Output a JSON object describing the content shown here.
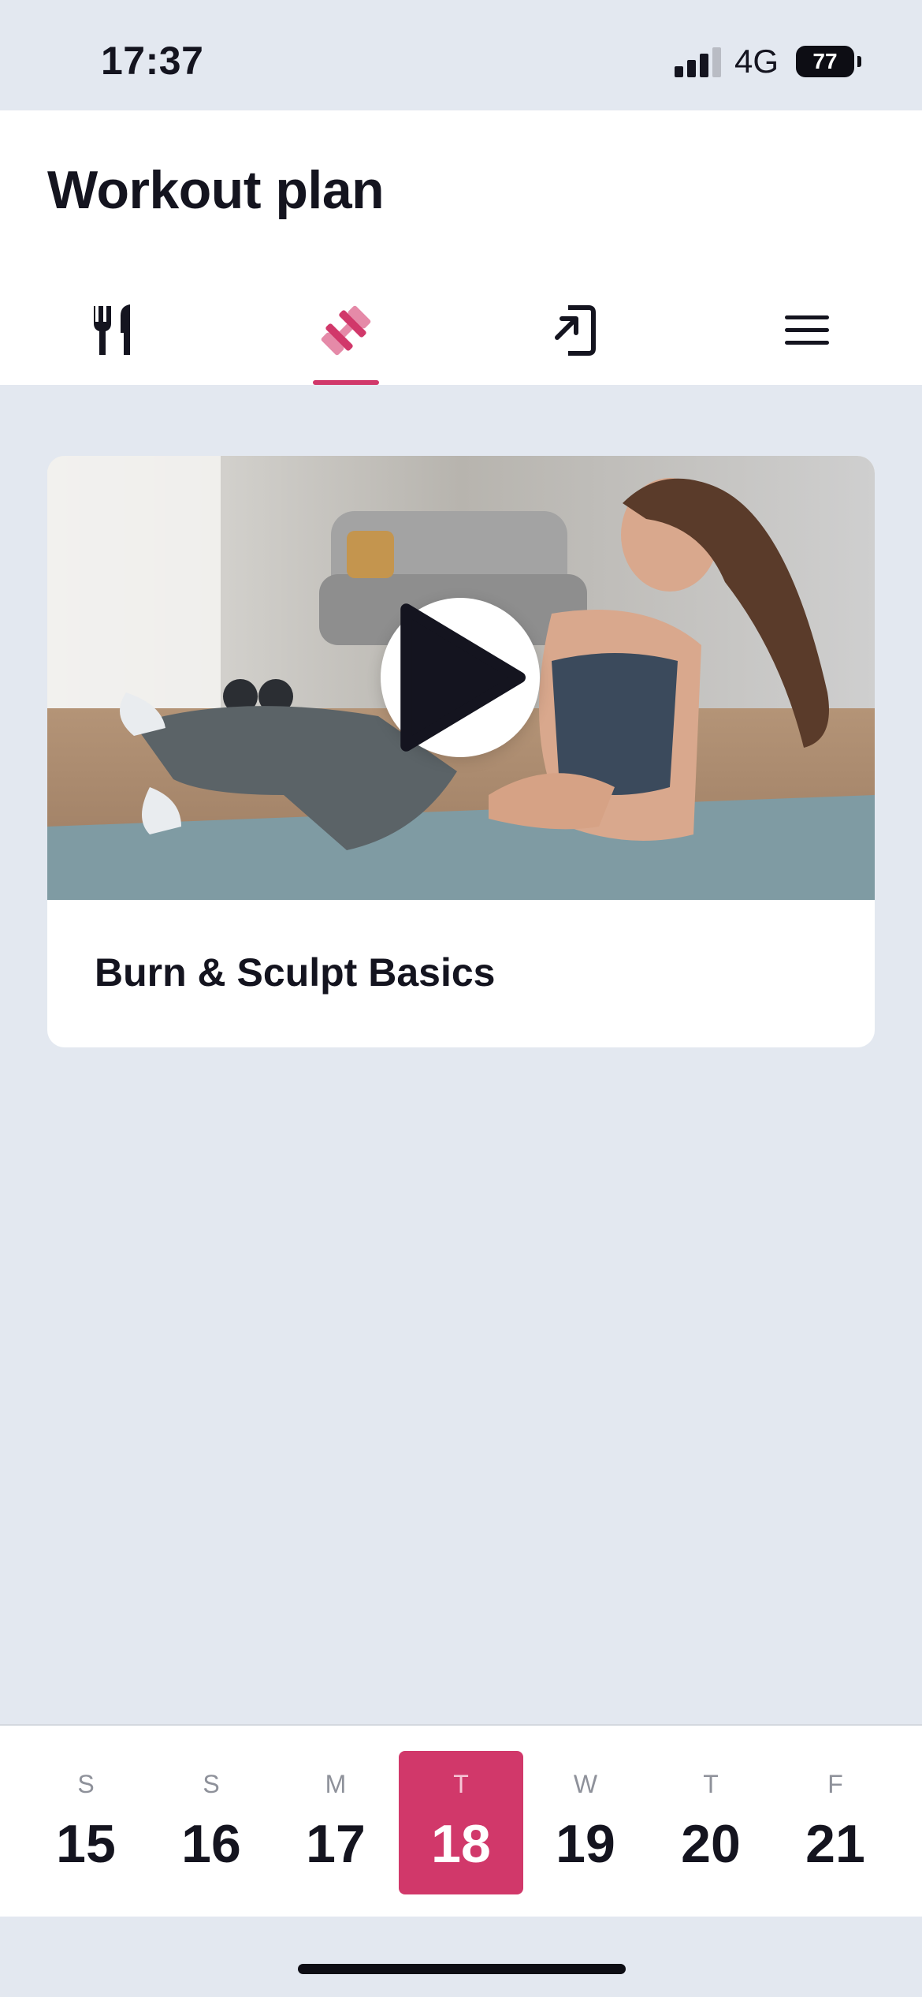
{
  "status_bar": {
    "time": "17:37",
    "network": "4G",
    "battery": "77",
    "signal_strength": 3
  },
  "header": {
    "title": "Workout plan",
    "tabs": [
      {
        "name": "nutrition",
        "icon": "fork-knife-icon",
        "active": false
      },
      {
        "name": "workout",
        "icon": "dumbbell-icon",
        "active": true
      },
      {
        "name": "login",
        "icon": "login-arrow-icon",
        "active": false
      },
      {
        "name": "menu",
        "icon": "hamburger-menu-icon",
        "active": false
      }
    ]
  },
  "workout_card": {
    "title": "Burn & Sculpt Basics",
    "image": "woman-doing-bicycle-crunches-photo",
    "play_icon": "play-icon"
  },
  "week": {
    "selected_index": 3,
    "days": [
      {
        "dow": "S",
        "date": "15"
      },
      {
        "dow": "S",
        "date": "16"
      },
      {
        "dow": "M",
        "date": "17"
      },
      {
        "dow": "T",
        "date": "18"
      },
      {
        "dow": "W",
        "date": "19"
      },
      {
        "dow": "T",
        "date": "20"
      },
      {
        "dow": "F",
        "date": "21"
      }
    ]
  },
  "colors": {
    "accent": "#d1386a",
    "background": "#e3e8f0",
    "text": "#14141f"
  }
}
